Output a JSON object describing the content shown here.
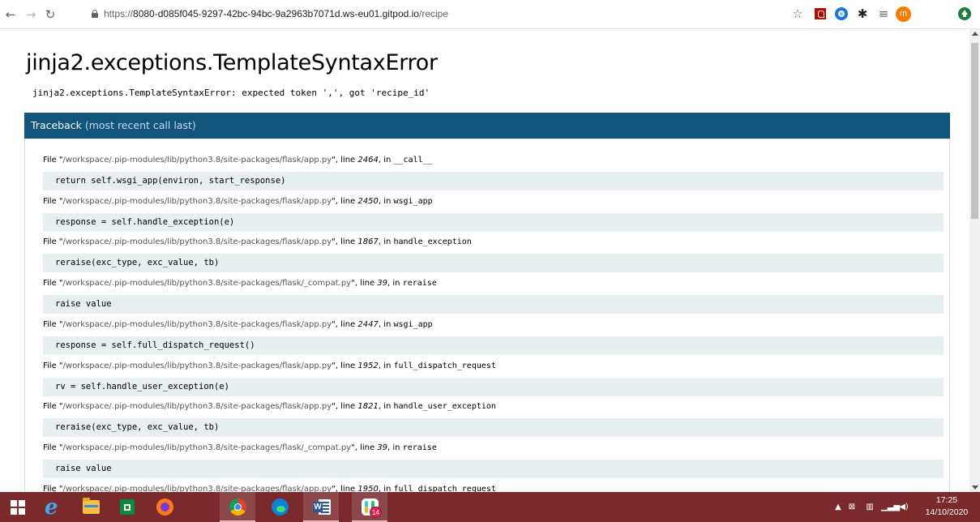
{
  "browser": {
    "url_prefix": "https://",
    "url_host": "8080-d085f045-9297-42bc-94bc-9a2963b7071d.ws-eu01.gitpod.io",
    "url_path": "/recipe",
    "profile_initial": "m"
  },
  "error": {
    "title": "jinja2.exceptions.TemplateSyntaxError",
    "message": "jinja2.exceptions.TemplateSyntaxError: expected token ',', got 'recipe_id'"
  },
  "traceback": {
    "heading": "Traceback",
    "subheading": "(most recent call last)",
    "frames": [
      {
        "path": "/workspace/.pip-modules/lib/python3.8/site-packages/flask/app.py",
        "line": "2464",
        "fn": "__call__",
        "code": "return self.wsgi_app(environ, start_response)"
      },
      {
        "path": "/workspace/.pip-modules/lib/python3.8/site-packages/flask/app.py",
        "line": "2450",
        "fn": "wsgi_app",
        "code": "response = self.handle_exception(e)"
      },
      {
        "path": "/workspace/.pip-modules/lib/python3.8/site-packages/flask/app.py",
        "line": "1867",
        "fn": "handle_exception",
        "code": "reraise(exc_type, exc_value, tb)"
      },
      {
        "path": "/workspace/.pip-modules/lib/python3.8/site-packages/flask/_compat.py",
        "line": "39",
        "fn": "reraise",
        "code": "raise value"
      },
      {
        "path": "/workspace/.pip-modules/lib/python3.8/site-packages/flask/app.py",
        "line": "2447",
        "fn": "wsgi_app",
        "code": "response = self.full_dispatch_request()"
      },
      {
        "path": "/workspace/.pip-modules/lib/python3.8/site-packages/flask/app.py",
        "line": "1952",
        "fn": "full_dispatch_request",
        "code": "rv = self.handle_user_exception(e)"
      },
      {
        "path": "/workspace/.pip-modules/lib/python3.8/site-packages/flask/app.py",
        "line": "1821",
        "fn": "handle_user_exception",
        "code": "reraise(exc_type, exc_value, tb)"
      },
      {
        "path": "/workspace/.pip-modules/lib/python3.8/site-packages/flask/_compat.py",
        "line": "39",
        "fn": "reraise",
        "code": "raise value"
      },
      {
        "path": "/workspace/.pip-modules/lib/python3.8/site-packages/flask/app.py",
        "line": "1950",
        "fn": "full_dispatch_request",
        "code": ""
      }
    ],
    "labels": {
      "file": "File",
      "line": "line",
      "in": "in"
    }
  },
  "taskbar": {
    "apps": [
      "windows-start",
      "internet-explorer",
      "file-explorer",
      "microsoft-store",
      "firefox",
      "chrome",
      "edge",
      "word",
      "slack"
    ],
    "slack_badge": "14",
    "time": "17:25",
    "date": "14/10/2020"
  },
  "colors": {
    "traceback_header": "#11557c",
    "code_background": "#e8eff0",
    "taskbar": "#7a2a2a"
  }
}
